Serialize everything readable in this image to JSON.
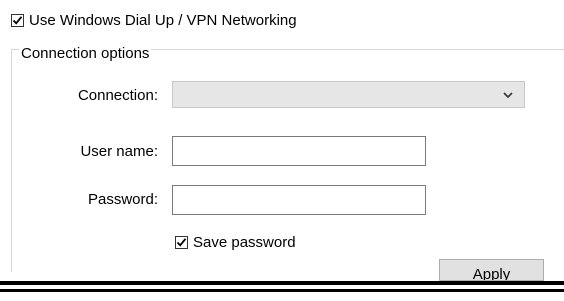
{
  "dialup": {
    "label": "Use Windows Dial Up / VPN Networking",
    "checked": true
  },
  "group": {
    "title": "Connection options",
    "connection_label": "Connection:",
    "connection_value": "",
    "username_label": "User name:",
    "username_value": "",
    "password_label": "Password:",
    "password_value": "",
    "save_password_label": "Save password",
    "save_password_checked": true
  },
  "apply_label": "Apply"
}
